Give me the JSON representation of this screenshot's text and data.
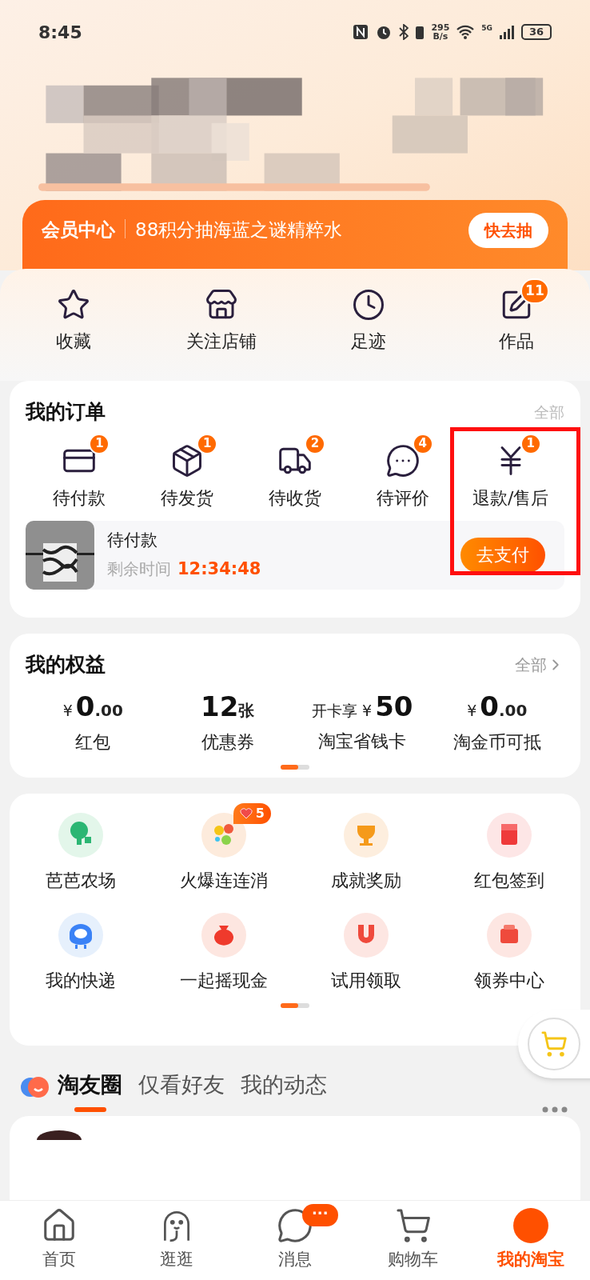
{
  "status_bar": {
    "time": "8:45",
    "speed": "295",
    "speed_unit": "B/s",
    "network": "5G",
    "battery": "36"
  },
  "member_banner": {
    "title": "会员中心",
    "text": "88积分抽海蓝之谜精粹水",
    "button": "快去抽"
  },
  "shortcuts": [
    {
      "label": "收藏"
    },
    {
      "label": "关注店铺"
    },
    {
      "label": "足迹"
    },
    {
      "label": "作品",
      "badge": "11"
    }
  ],
  "orders": {
    "title": "我的订单",
    "more": "全部",
    "items": [
      {
        "label": "待付款",
        "badge": "1"
      },
      {
        "label": "待发货",
        "badge": "1"
      },
      {
        "label": "待收货",
        "badge": "2"
      },
      {
        "label": "待评价",
        "badge": "4"
      },
      {
        "label": "退款/售后",
        "badge": "1",
        "highlighted": true
      }
    ],
    "pending": {
      "title": "待付款",
      "time_label": "剩余时间",
      "time": "12:34:48",
      "button": "去支付"
    }
  },
  "benefits": {
    "title": "我的权益",
    "more": "全部",
    "items": [
      {
        "prefix": "¥",
        "value": "0",
        "suffix": ".00",
        "label": "红包"
      },
      {
        "value": "12",
        "suffix": "张",
        "label": "优惠券"
      },
      {
        "prefix": "开卡享 ¥",
        "value": "50",
        "label": "淘宝省钱卡"
      },
      {
        "prefix": "¥",
        "value": "0",
        "suffix": ".00",
        "label": "淘金币可抵"
      }
    ]
  },
  "services": {
    "items": [
      {
        "label": "芭芭农场"
      },
      {
        "label": "火爆连连消",
        "badge": "5"
      },
      {
        "label": "成就奖励"
      },
      {
        "label": "红包签到"
      },
      {
        "label": "我的快递"
      },
      {
        "label": "一起摇现金"
      },
      {
        "label": "试用领取"
      },
      {
        "label": "领券中心"
      }
    ]
  },
  "feed_tabs": [
    {
      "label": "淘友圈",
      "selected": true
    },
    {
      "label": "仅看好友",
      "selected": false
    },
    {
      "label": "我的动态",
      "selected": false
    }
  ],
  "nav": [
    {
      "label": "首页",
      "selected": false
    },
    {
      "label": "逛逛",
      "selected": false
    },
    {
      "label": "消息",
      "selected": false,
      "badge": "···"
    },
    {
      "label": "购物车",
      "selected": false
    },
    {
      "label": "我的淘宝",
      "selected": true
    }
  ]
}
